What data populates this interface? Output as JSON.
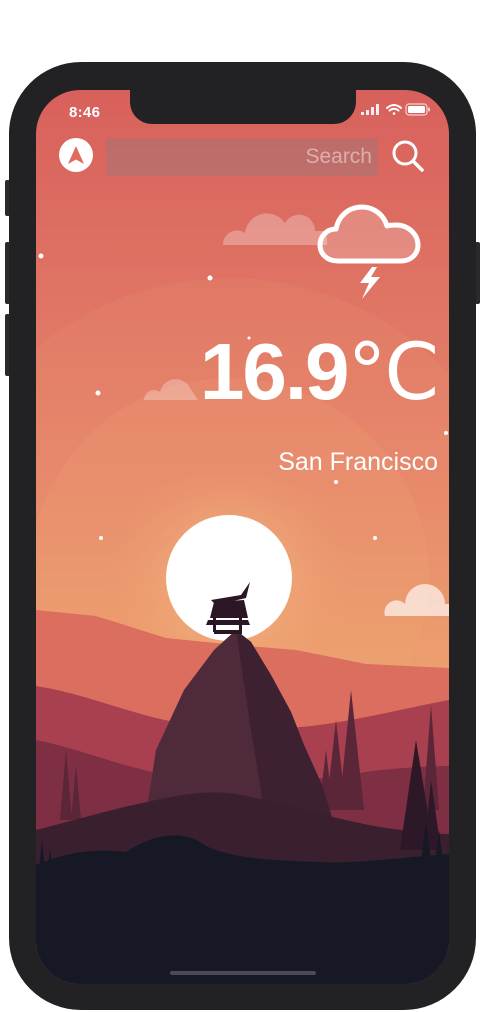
{
  "status_bar": {
    "time": "8:46",
    "icons": [
      "signal-icon",
      "wifi-icon",
      "battery-icon"
    ]
  },
  "header": {
    "location_button_icon": "navigation-arrow-icon",
    "search": {
      "placeholder": "Search",
      "value": ""
    },
    "search_button_icon": "search-icon"
  },
  "weather": {
    "condition_icon": "thunderstorm-cloud-icon",
    "temperature": "16.9",
    "unit": "°C",
    "city": "San Francisco"
  },
  "colors": {
    "sky_top": "#da625d",
    "sky_bottom": "#f0b572",
    "sun": "#ffffff",
    "ground": "#161925",
    "text": "#ffffff"
  }
}
